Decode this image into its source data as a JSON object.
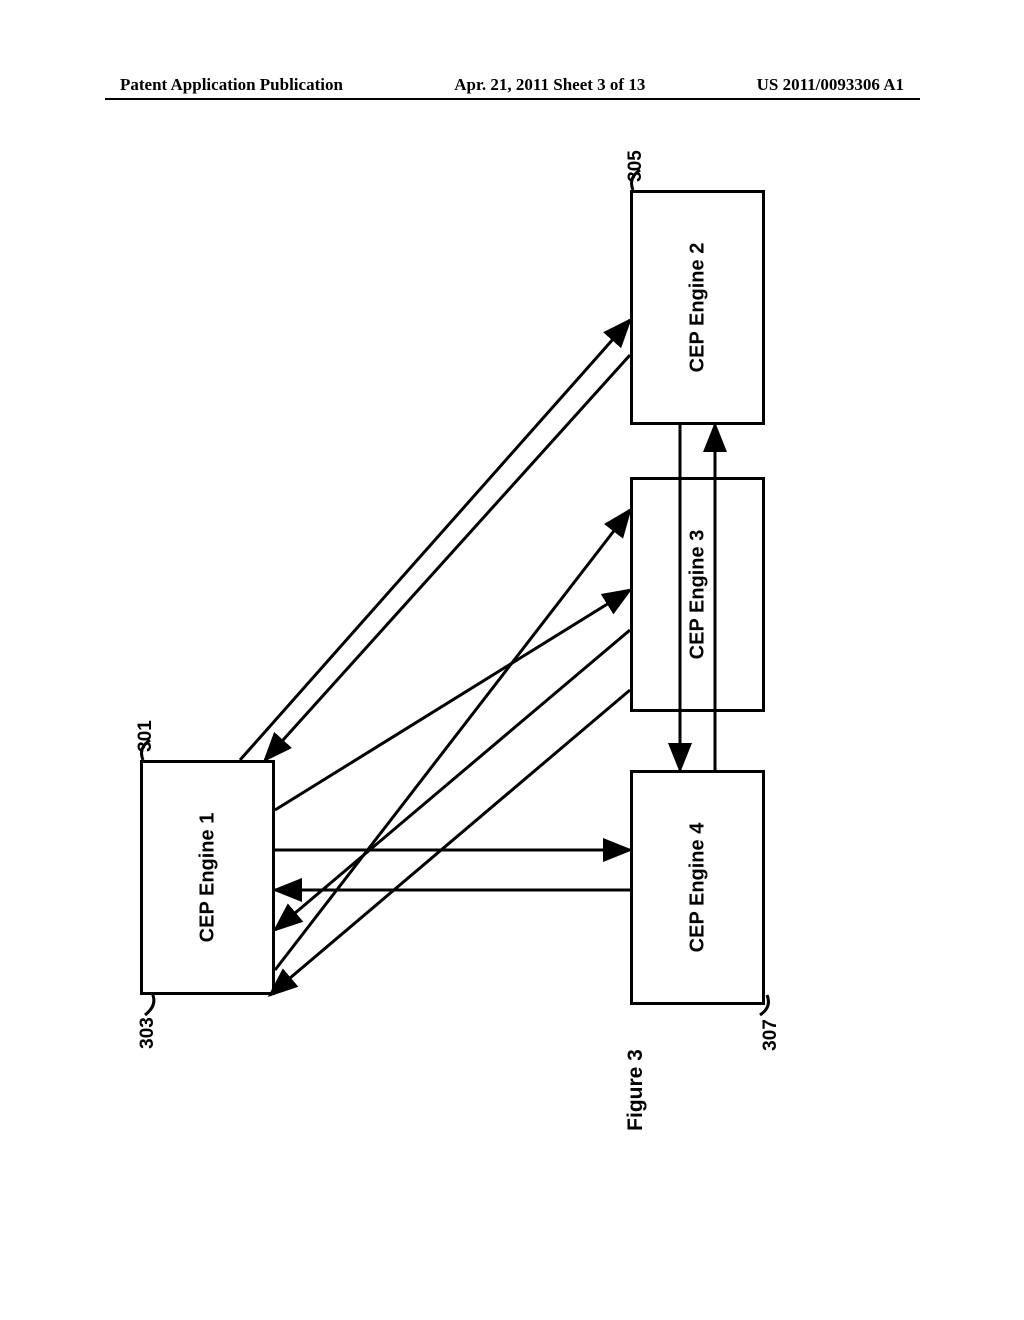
{
  "header": {
    "left": "Patent Application Publication",
    "center": "Apr. 21, 2011  Sheet 3 of 13",
    "right": "US 2011/0093306 A1"
  },
  "boxes": {
    "box1": {
      "label": "CEP Engine 1",
      "ref": "301"
    },
    "box2": {
      "label": "CEP Engine 2",
      "ref": "305"
    },
    "box3": {
      "label": "CEP Engine 4",
      "ref": "307"
    },
    "box4": {
      "label": "CEP Engine 3",
      "ref": "303"
    }
  },
  "figure_label": "Figure 3"
}
